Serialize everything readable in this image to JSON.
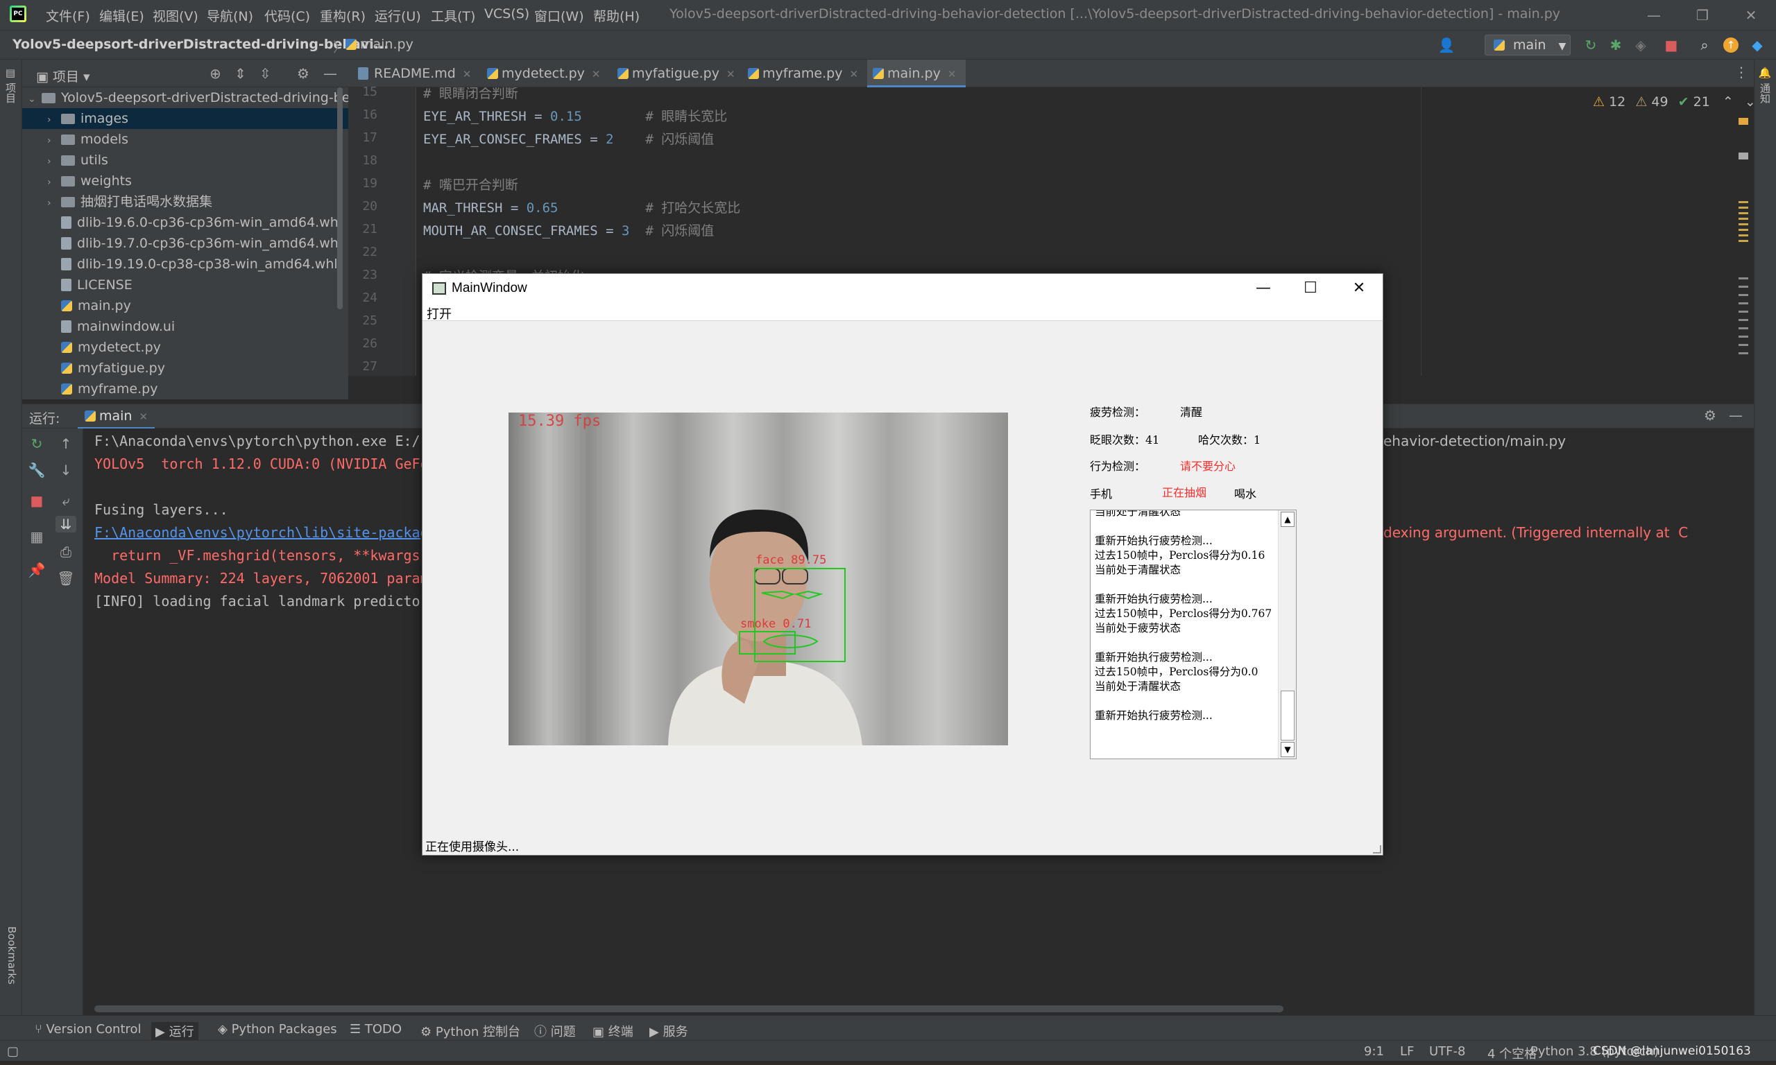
{
  "menubar": {
    "items": [
      "文件(F)",
      "编辑(E)",
      "视图(V)",
      "导航(N)",
      "代码(C)",
      "重构(R)",
      "运行(U)",
      "工具(T)",
      "VCS(S)",
      "窗口(W)",
      "帮助(H)"
    ],
    "window_title": "Yolov5-deepsort-driverDistracted-driving-behavior-detection [...\\Yolov5-deepsort-driverDistracted-driving-behavior-detection] - main.py"
  },
  "navbar": {
    "project": "Yolov5-deepsort-driverDistracted-driving-behavi...",
    "file": "main.py",
    "run_config": "main"
  },
  "project_panel": {
    "title": "项目",
    "root": "Yolov5-deepsort-driverDistracted-driving-beh",
    "items": [
      {
        "label": "images",
        "kind": "folder"
      },
      {
        "label": "models",
        "kind": "folder"
      },
      {
        "label": "utils",
        "kind": "folder"
      },
      {
        "label": "weights",
        "kind": "folder"
      },
      {
        "label": "抽烟打电话喝水数据集",
        "kind": "folder"
      },
      {
        "label": "dlib-19.6.0-cp36-cp36m-win_amd64.whl",
        "kind": "file"
      },
      {
        "label": "dlib-19.7.0-cp36-cp36m-win_amd64.whl",
        "kind": "file"
      },
      {
        "label": "dlib-19.19.0-cp38-cp38-win_amd64.whl",
        "kind": "file"
      },
      {
        "label": "LICENSE",
        "kind": "file"
      },
      {
        "label": "main.py",
        "kind": "py"
      },
      {
        "label": "mainwindow.ui",
        "kind": "file"
      },
      {
        "label": "mydetect.py",
        "kind": "py"
      },
      {
        "label": "myfatigue.py",
        "kind": "py"
      },
      {
        "label": "myframe.py",
        "kind": "py"
      }
    ]
  },
  "tabs": [
    "README.md",
    "mydetect.py",
    "myfatigue.py",
    "myframe.py",
    "main.py"
  ],
  "editor": {
    "lines": [
      {
        "n": "15",
        "code": "# 眼睛闭合判断"
      },
      {
        "n": "16",
        "code": "EYE_AR_THRESH = 0.15        # 眼睛长宽比"
      },
      {
        "n": "17",
        "code": "EYE_AR_CONSEC_FRAMES = 2    # 闪烁阈值"
      },
      {
        "n": "18",
        "code": ""
      },
      {
        "n": "19",
        "code": "# 嘴巴开合判断"
      },
      {
        "n": "20",
        "code": "MAR_THRESH = 0.65           # 打哈欠长宽比"
      },
      {
        "n": "21",
        "code": "MOUTH_AR_CONSEC_FRAMES = 3  # 闪烁阈值"
      },
      {
        "n": "22",
        "code": ""
      },
      {
        "n": "23",
        "code": "# 定义检测变量，并初始化"
      },
      {
        "n": "24",
        "code": ""
      },
      {
        "n": "25",
        "code": ""
      },
      {
        "n": "26",
        "code": ""
      },
      {
        "n": "27",
        "code": ""
      }
    ],
    "inspections": {
      "warnings": "12",
      "weak": "49",
      "ok": "21"
    }
  },
  "run_panel": {
    "label": "运行:",
    "tab": "main",
    "console": [
      {
        "text": "F:\\Anaconda\\envs\\pytorch\\python.exe E:/(",
        "style": "nrm"
      },
      {
        "text": "YOLOv5  torch 1.12.0 CUDA:0 (NVIDIA GeFo",
        "style": "err"
      },
      {
        "text": "",
        "style": "nrm"
      },
      {
        "text": "Fusing layers...",
        "style": "nrm"
      },
      {
        "text": "F:\\Anaconda\\envs\\pytorch\\lib\\site-packag",
        "style": "link"
      },
      {
        "text": "  return _VF.meshgrid(tensors, **kwargs)",
        "style": "err"
      },
      {
        "text": "Model Summary: 224 layers, 7062001 param",
        "style": "err"
      },
      {
        "text": "[INFO] loading facial landmark predictor",
        "style": "nrm"
      }
    ],
    "console_right_1": "ehavior-detection/main.py",
    "console_right_2": "dexing argument. (Triggered internally at  C"
  },
  "bottom_tools": [
    "Version Control",
    "运行",
    "Python Packages",
    "TODO",
    "Python 控制台",
    "问题",
    "终端",
    "服务"
  ],
  "statusbar": {
    "position": "9:1",
    "line_sep": "LF",
    "encoding": "UTF-8",
    "indent": "4 个空格",
    "interpreter": "Python 3.8 (pytorch)",
    "watermark": "CSDN @lanjunwei0150163"
  },
  "qt_window": {
    "title": "MainWindow",
    "menu": "打开",
    "fps": "15.39 fps",
    "face_label": "face 89.75",
    "smoke_label": "smoke 0.71",
    "fatigue_label": "疲劳检测：",
    "fatigue_value": "清醒",
    "blink_label": "眨眼次数：41",
    "yawn_label": "哈欠次数：1",
    "behavior_label": "行为检测：",
    "behavior_value": "请不要分心",
    "phone_label": "手机",
    "smoking_label": "正在抽烟",
    "drink_label": "喝水",
    "log": "当前处于清醒状态\n\n重新开始执行疲劳检测...\n过去150帧中，Perclos得分为0.16\n当前处于清醒状态\n\n重新开始执行疲劳检测...\n过去150帧中，Perclos得分为0.767\n当前处于疲劳状态\n\n重新开始执行疲劳检测...\n过去150帧中，Perclos得分为0.0\n当前处于清醒状态\n\n重新开始执行疲劳检测...",
    "status": "正在使用摄像头..."
  },
  "colors": {
    "accent": "#4a88c7",
    "error": "#ff6b68",
    "qt_red": "#ff2a2a",
    "box_green": "#22c822"
  }
}
